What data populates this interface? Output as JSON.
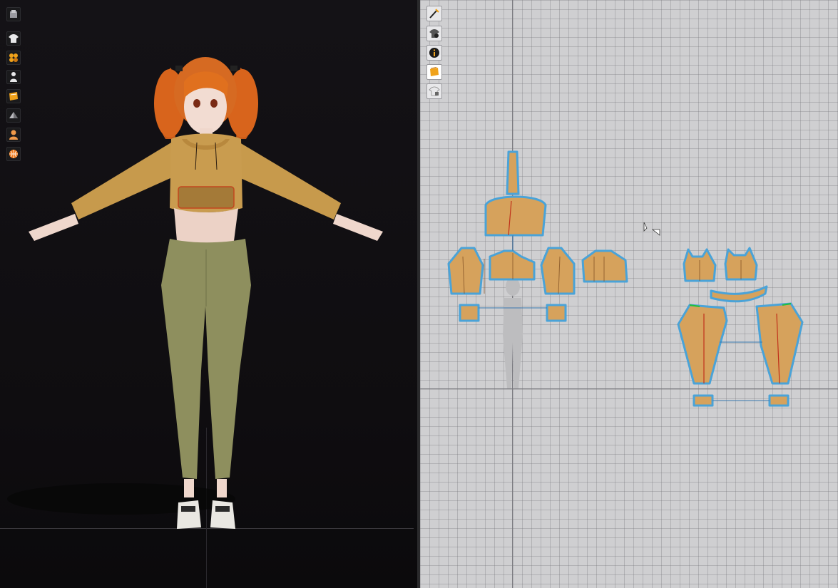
{
  "left_toolbar": {
    "tools": [
      {
        "icon": "avatar-display-icon"
      },
      {
        "icon": "garment-display-icon"
      },
      {
        "icon": "texture-display-icon"
      },
      {
        "icon": "avatar-pose-icon"
      },
      {
        "icon": "fabric-display-icon"
      },
      {
        "icon": "shading-icon"
      },
      {
        "icon": "skin-display-icon"
      },
      {
        "icon": "world-display-icon"
      }
    ]
  },
  "right_toolbar": {
    "tools": [
      {
        "icon": "edit-pattern-icon"
      },
      {
        "icon": "avatar-silhouette-icon"
      },
      {
        "icon": "info-icon"
      },
      {
        "icon": "texture-2d-icon"
      },
      {
        "icon": "lock-garment-icon"
      }
    ]
  },
  "colors": {
    "pattern_fill": "#d6a25c",
    "pattern_outline": "#4aa3d8",
    "hoodie": "#c79a4c",
    "leggings": "#8e8f5e",
    "hair": "#d8641c"
  }
}
